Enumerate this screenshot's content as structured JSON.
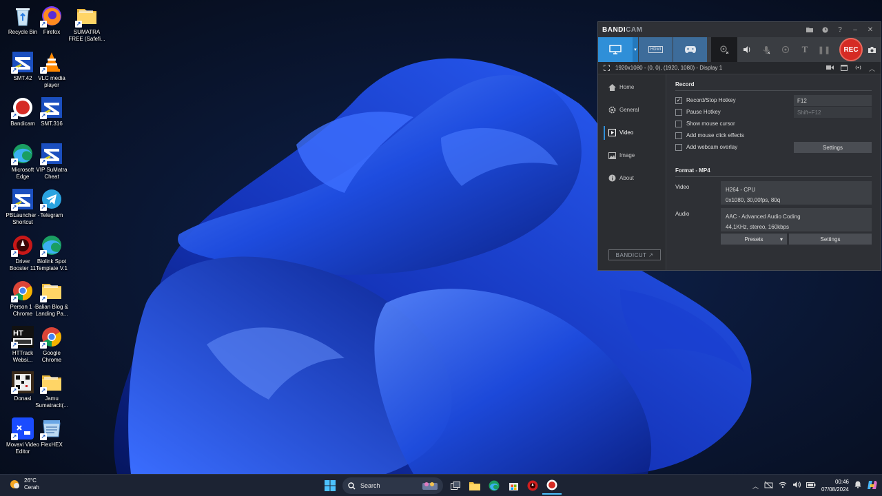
{
  "desktop": {
    "icons": [
      {
        "label": "Recycle Bin",
        "icon": "recycle-bin-icon"
      },
      {
        "label": "Firefox",
        "icon": "firefox-icon"
      },
      {
        "label": "SUMATRA\nFREE (Safefi...",
        "icon": "folder-icon"
      },
      {
        "label": "SMT.42",
        "icon": "smt-icon"
      },
      {
        "label": "VLC media\nplayer",
        "icon": "vlc-icon"
      },
      {
        "label": "Bandicam",
        "icon": "bandicam-icon"
      },
      {
        "label": "SMT.316",
        "icon": "smt-icon"
      },
      {
        "label": "Microsoft\nEdge",
        "icon": "edge-icon"
      },
      {
        "label": "VIP SuMatra\nCheat",
        "icon": "smt-icon"
      },
      {
        "label": "PBLauncher -\nShortcut",
        "icon": "smt-icon"
      },
      {
        "label": "Telegram",
        "icon": "telegram-icon"
      },
      {
        "label": "Driver\nBooster 11",
        "icon": "driver-booster-icon"
      },
      {
        "label": "Biolink Spot\nTemplate V.1",
        "icon": "edge-icon"
      },
      {
        "label": "Person 1 -\nChrome",
        "icon": "chrome-icon"
      },
      {
        "label": "Balian Blog &\nLanding Pa...",
        "icon": "folder-icon"
      },
      {
        "label": "HTTrack\nWebsi...",
        "icon": "httrack-icon"
      },
      {
        "label": "Google\nChrome",
        "icon": "chrome-icon"
      },
      {
        "label": "Donasi",
        "icon": "qr-image-icon"
      },
      {
        "label": "Jamu\nSumatracit(...",
        "icon": "folder-icon"
      },
      {
        "label": "Movavi Video\nEditor",
        "icon": "movavi-icon"
      },
      {
        "label": "FlexHEX",
        "icon": "flexhex-icon"
      }
    ]
  },
  "bandicam": {
    "logo_main": "BANDI",
    "logo_sub": "CAM",
    "rec_label": "REC",
    "hdmi_label": "HDMI",
    "area_text": "1920x1080 - (0, 0), (1920, 1080) - Display 1",
    "sidebar": [
      {
        "label": "Home",
        "icon": "home-icon"
      },
      {
        "label": "General",
        "icon": "gear-icon"
      },
      {
        "label": "Video",
        "icon": "video-icon",
        "active": true
      },
      {
        "label": "Image",
        "icon": "image-icon"
      },
      {
        "label": "About",
        "icon": "info-icon"
      }
    ],
    "bandicut_label": "BANDICUT ↗",
    "record": {
      "title": "Record",
      "options": [
        {
          "label": "Record/Stop Hotkey",
          "checked": true,
          "hotkey": "F12"
        },
        {
          "label": "Pause Hotkey",
          "checked": false,
          "hotkey": "Shift+F12"
        },
        {
          "label": "Show mouse cursor",
          "checked": false
        },
        {
          "label": "Add mouse click effects",
          "checked": false
        },
        {
          "label": "Add webcam overlay",
          "checked": false
        }
      ],
      "settings_label": "Settings"
    },
    "format": {
      "title": "Format",
      "container": "MP4",
      "video_label": "Video",
      "video_codec": "H264 - CPU",
      "video_detail": "0x1080, 30,00fps, 80q",
      "audio_label": "Audio",
      "audio_codec": "AAC - Advanced Audio Coding",
      "audio_detail": "44,1KHz, stereo, 160kbps",
      "presets_label": "Presets",
      "settings_label": "Settings"
    }
  },
  "taskbar": {
    "weather_temp": "26°C",
    "weather_desc": "Cerah",
    "search_placeholder": "Search",
    "time": "00:46",
    "date": "07/08/2024"
  },
  "colors": {
    "accent": "#2f8fd8",
    "rec": "#d52b24",
    "taskbar": "#1c2333"
  }
}
